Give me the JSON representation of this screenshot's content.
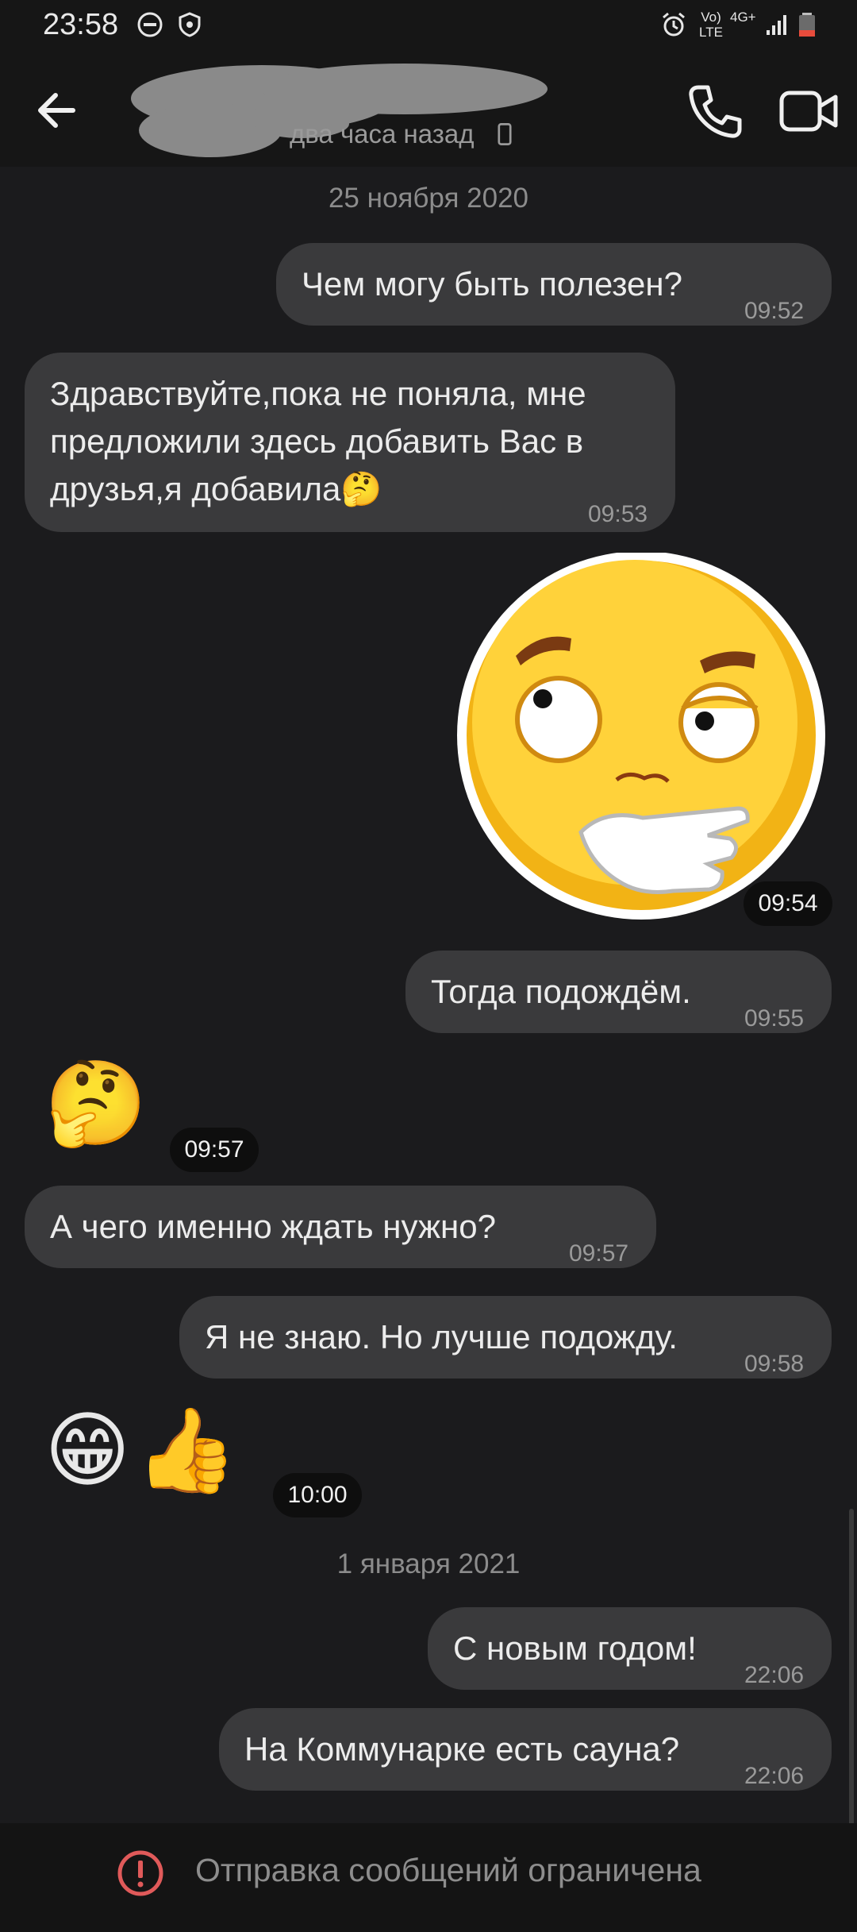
{
  "status_bar": {
    "time": "23:58",
    "icons": [
      "do-not-disturb-icon",
      "shield-icon",
      "alarm-icon",
      "volte-icon",
      "4g-icon",
      "signal-icon",
      "battery-icon"
    ],
    "volte_label": "Vo) LTE",
    "network_label": "4G+"
  },
  "header": {
    "last_seen": "два часа назад",
    "icons": [
      "back-arrow-icon",
      "phone-icon",
      "video-camera-icon"
    ]
  },
  "chat": {
    "date_1": "25 ноября 2020",
    "date_2": "1 января 2021",
    "messages": [
      {
        "side": "out",
        "text": "Чем могу быть полезен?",
        "time": "09:52"
      },
      {
        "side": "in",
        "text": "Здравствуйте,пока не поняла, мне\nпредложили здесь добавить Вас в\nдрузья,я добавила🤔",
        "time": "09:53"
      },
      {
        "side": "out",
        "type": "sticker",
        "sticker": "thinking-face-sticker",
        "time": "09:54"
      },
      {
        "side": "out",
        "text": "Тогда подождём.",
        "time": "09:55"
      },
      {
        "side": "in",
        "type": "emoji",
        "emoji": "🤔",
        "time": "09:57"
      },
      {
        "side": "in",
        "text": "А чего именно ждать нужно?",
        "time": "09:57"
      },
      {
        "side": "out",
        "text": "Я не знаю. Но лучше подожду.",
        "time": "09:58"
      },
      {
        "side": "in",
        "type": "emoji",
        "emoji": "😁👍",
        "time": "10:00"
      },
      {
        "side": "out",
        "text": "С новым годом!",
        "time": "22:06"
      },
      {
        "side": "out",
        "text": "На Коммунарке есть сауна?",
        "time": "22:06"
      }
    ]
  },
  "footer": {
    "notice": "Отправка сообщений ограничена",
    "icon": "warning-circle-icon",
    "accent_color": "#e05a5a"
  },
  "colors": {
    "background": "#1b1b1d",
    "bubble": "#3a3a3c",
    "sticker_yellow": "#ffd23a"
  }
}
